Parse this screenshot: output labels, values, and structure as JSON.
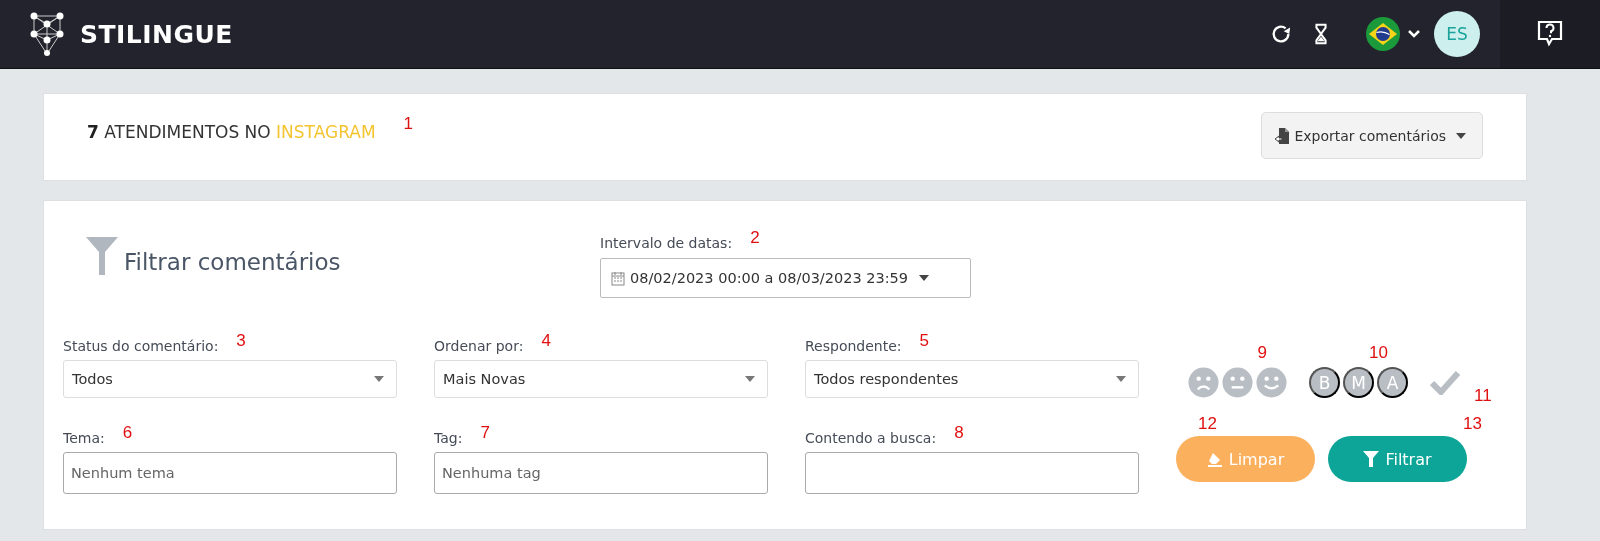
{
  "navbar": {
    "brand": "STILINGUE",
    "avatar": "ES"
  },
  "summary": {
    "count": "7",
    "text": "ATENDIMENTOS NO",
    "network": "INSTAGRAM",
    "marker": "1",
    "export_button": "Exportar comentários"
  },
  "filters": {
    "title": "Filtrar comentários",
    "date_range": {
      "label": "Intervalo de datas:",
      "value": "08/02/2023 00:00 a 08/03/2023 23:59",
      "marker": "2"
    },
    "fields": [
      {
        "kind": "select",
        "label": "Status do comentário:",
        "value": "Todos",
        "marker": "3"
      },
      {
        "kind": "select",
        "label": "Ordenar por:",
        "value": "Mais Novas",
        "marker": "4"
      },
      {
        "kind": "select",
        "label": "Respondente:",
        "value": "Todos respondentes",
        "marker": "5"
      },
      {
        "kind": "input",
        "label": "Tema:",
        "placeholder": "Nenhum tema",
        "marker": "6"
      },
      {
        "kind": "input",
        "label": "Tag:",
        "placeholder": "Nenhuma tag",
        "marker": "7"
      },
      {
        "kind": "input",
        "label": "Contendo a busca:",
        "marker": "8"
      }
    ],
    "sentiment": {
      "marker": "9",
      "options": [
        {
          "kind": "sad",
          "selected": false
        },
        {
          "kind": "neutral",
          "selected": false
        },
        {
          "kind": "happy",
          "selected": false
        }
      ]
    },
    "levels": {
      "marker": "10",
      "options": [
        {
          "letter": "B",
          "selected": false
        },
        {
          "letter": "M",
          "selected": false
        },
        {
          "letter": "A",
          "selected": false
        }
      ]
    },
    "answered": {
      "marker": "11",
      "selected": false
    },
    "clear_button": {
      "label": "Limpar",
      "marker": "12"
    },
    "filter_button": {
      "label": "Filtrar",
      "marker": "13"
    }
  }
}
